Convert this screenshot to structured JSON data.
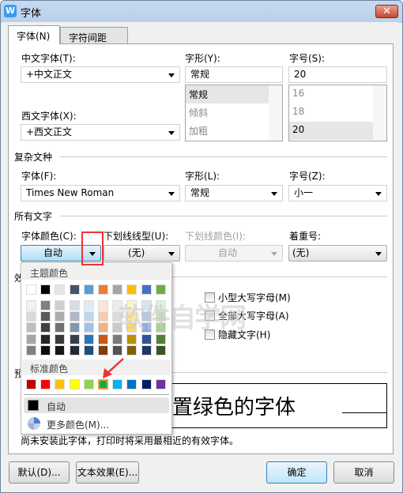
{
  "window": {
    "title": "字体",
    "logo": "W",
    "close": "✕"
  },
  "tabs": [
    {
      "label": "字体(N)",
      "active": true
    },
    {
      "label": "字符间距(R)",
      "active": false
    }
  ],
  "font": {
    "cn_label": "中文字体(T):",
    "cn_value": "+中文正文",
    "style_label": "字形(Y):",
    "style_value": "常规",
    "style_options": [
      "常规",
      "倾斜",
      "加粗"
    ],
    "size_label": "字号(S):",
    "size_value": "20",
    "size_options": [
      "16",
      "18",
      "20"
    ],
    "west_label": "西文字体(X):",
    "west_value": "+西文正文"
  },
  "complex": {
    "section": "复杂文种",
    "font_label": "字体(F):",
    "font_value": "Times New Roman",
    "style_label": "字形(L):",
    "style_value": "常规",
    "size_label": "字号(Z):",
    "size_value": "小一"
  },
  "all_text": {
    "section": "所有文字",
    "color_label": "字体颜色(C):",
    "color_value": "自动",
    "underline_label": "下划线线型(U):",
    "underline_value": "(无)",
    "underline_color_label": "下划线颜色(I):",
    "underline_color_value": "自动",
    "emphasis_label": "着重号:",
    "emphasis_value": "(无)"
  },
  "effects": {
    "section": "效果",
    "options": [
      "小型大写字母(M)",
      "全部大写字母(A)",
      "隐藏文字(H)"
    ]
  },
  "preview": {
    "section": "预览",
    "text": "置绿色的字体"
  },
  "note": "尚未安装此字体，打印时将采用最相近的有效字体。",
  "buttons": {
    "default": "默认(D)...",
    "text_effects": "文本效果(E)...",
    "ok": "确定",
    "cancel": "取消"
  },
  "color_popup": {
    "theme_label": "主题颜色",
    "theme_colors": [
      "#ffffff",
      "#000000",
      "#e7e6e6",
      "#44546a",
      "#5b9bd5",
      "#ed7d31",
      "#a5a5a5",
      "#ffc000",
      "#4472c4",
      "#70ad47"
    ],
    "theme_shades": [
      [
        "#f2f2f2",
        "#7f7f7f",
        "#d0cece",
        "#d6dce4",
        "#deebf6",
        "#fbe5d5",
        "#ededed",
        "#fff2cc",
        "#dae3f3",
        "#e2efd9"
      ],
      [
        "#d9d9d9",
        "#595959",
        "#aeabab",
        "#adb9ca",
        "#bdd7ee",
        "#f8cbad",
        "#dbdbdb",
        "#ffe699",
        "#b4c7e7",
        "#c5e0b4"
      ],
      [
        "#bfbfbf",
        "#404040",
        "#757070",
        "#8496b0",
        "#9dc3e6",
        "#f4b183",
        "#c9c9c9",
        "#ffd966",
        "#8faadc",
        "#a9d18e"
      ],
      [
        "#a6a6a6",
        "#262626",
        "#3a3838",
        "#333f4f",
        "#2e75b5",
        "#c55a11",
        "#7b7b7b",
        "#bf9000",
        "#2f5597",
        "#538135"
      ],
      [
        "#808080",
        "#0d0d0d",
        "#171616",
        "#222a35",
        "#1f4e79",
        "#833c0b",
        "#525252",
        "#7f6000",
        "#203864",
        "#375623"
      ]
    ],
    "standard_label": "标准颜色",
    "standard_colors": [
      "#c00000",
      "#ff0000",
      "#ffc000",
      "#ffff00",
      "#92d050",
      "#00b050",
      "#00b0f0",
      "#0070c0",
      "#002060",
      "#7030a0"
    ],
    "selected_standard": "#00b050",
    "auto_label": "自动",
    "more_label": "更多颜色(M)..."
  },
  "watermark": {
    "text": "软件自学网",
    "url": "WWW.RJZXW.COM"
  },
  "annotation_color": "#ee3333"
}
